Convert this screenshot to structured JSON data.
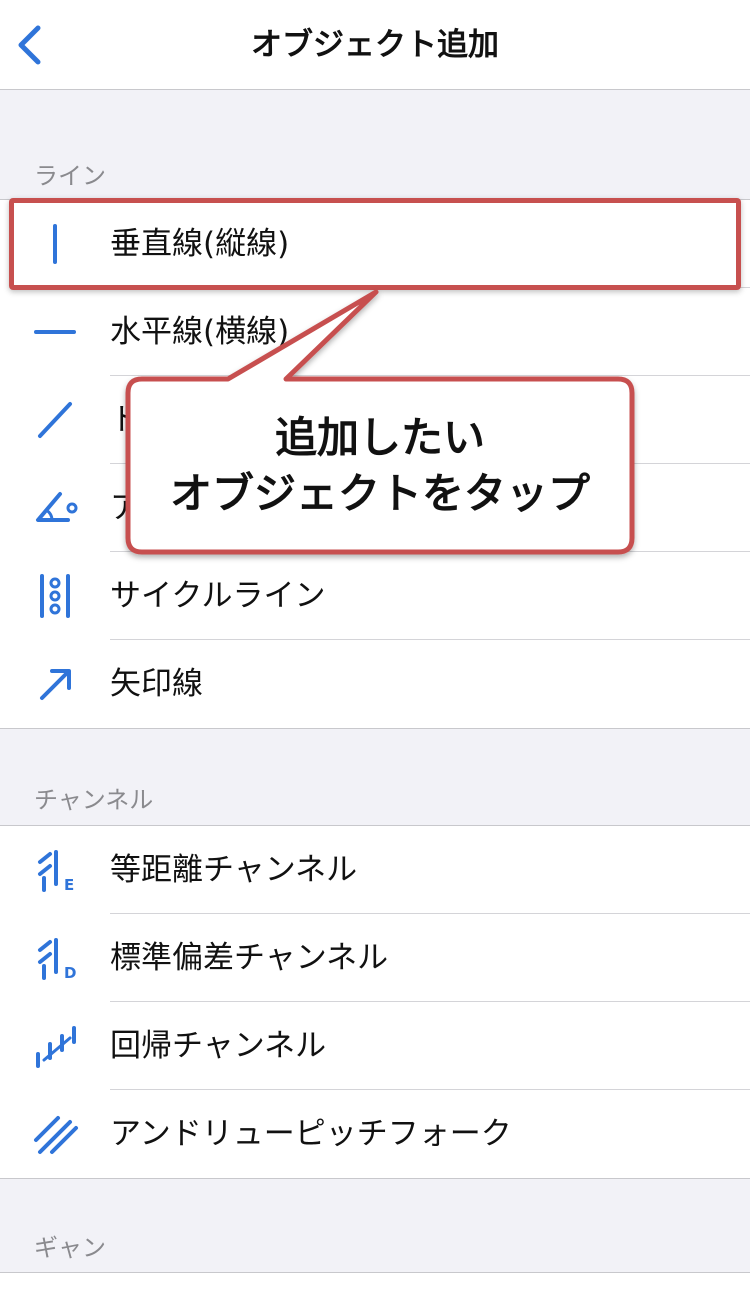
{
  "header": {
    "title": "オブジェクト追加",
    "back_icon": "chevron-left-icon"
  },
  "accent_color": "#2f74d9",
  "highlight_color": "#c7504f",
  "sections": [
    {
      "title": "ライン",
      "items": [
        {
          "label": "垂直線(縦線)",
          "icon": "vertical-line-icon"
        },
        {
          "label": "水平線(横線)",
          "icon": "horizontal-line-icon"
        },
        {
          "label": "ト",
          "icon": "trendline-icon"
        },
        {
          "label": "ア",
          "icon": "angle-icon"
        },
        {
          "label": "サイクルライン",
          "icon": "cycle-lines-icon"
        },
        {
          "label": "矢印線",
          "icon": "arrow-icon"
        }
      ]
    },
    {
      "title": "チャンネル",
      "items": [
        {
          "label": "等距離チャンネル",
          "icon": "equidistant-channel-icon"
        },
        {
          "label": "標準偏差チャンネル",
          "icon": "std-dev-channel-icon"
        },
        {
          "label": "回帰チャンネル",
          "icon": "regression-channel-icon"
        },
        {
          "label": "アンドリューピッチフォーク",
          "icon": "pitchfork-icon"
        }
      ]
    },
    {
      "title": "ギャン",
      "items": []
    }
  ],
  "callout": {
    "line1": "追加したい",
    "line2": "オブジェクトをタップ"
  }
}
